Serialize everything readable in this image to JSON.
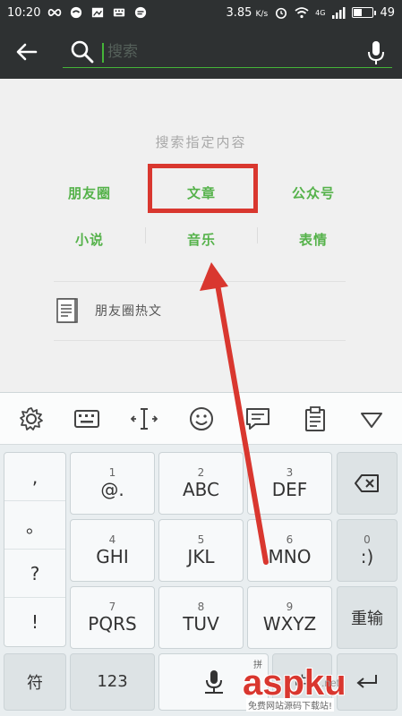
{
  "status_bar": {
    "time": "10:20",
    "speed": "3.85",
    "speed_unit": "K/s",
    "network": "4G",
    "battery": "49",
    "battery_level": 0.49
  },
  "search": {
    "placeholder": "搜索",
    "value": ""
  },
  "content": {
    "hint": "搜索指定内容",
    "categories": [
      {
        "label": "朋友圈"
      },
      {
        "label": "文章"
      },
      {
        "label": "公众号"
      },
      {
        "label": "小说"
      },
      {
        "label": "音乐"
      },
      {
        "label": "表情"
      }
    ],
    "hot_item": "朋友圈热文"
  },
  "keyboard": {
    "punctuation": [
      ",",
      "。",
      "?",
      "!"
    ],
    "keys": [
      {
        "num": "1",
        "label": "@."
      },
      {
        "num": "2",
        "label": "ABC"
      },
      {
        "num": "3",
        "label": "DEF"
      },
      {
        "num": "4",
        "label": "GHI"
      },
      {
        "num": "5",
        "label": "JKL"
      },
      {
        "num": "6",
        "label": "MNO"
      },
      {
        "num": "0",
        "label": ":)"
      },
      {
        "num": "7",
        "label": "PQRS"
      },
      {
        "num": "8",
        "label": "TUV"
      },
      {
        "num": "9",
        "label": "WXYZ"
      }
    ],
    "reinput": "重输",
    "symbol": "符",
    "numeric": "123",
    "space_hint": "拼",
    "chinese_toggle": "中"
  },
  "watermark": {
    "main": "aspku",
    "sub": ".net",
    "caption": "免费网站源码下载站!"
  },
  "colors": {
    "accent": "#45b538",
    "category": "#55b24a",
    "highlight": "#d9372f",
    "bar_bg": "#2e3132"
  }
}
